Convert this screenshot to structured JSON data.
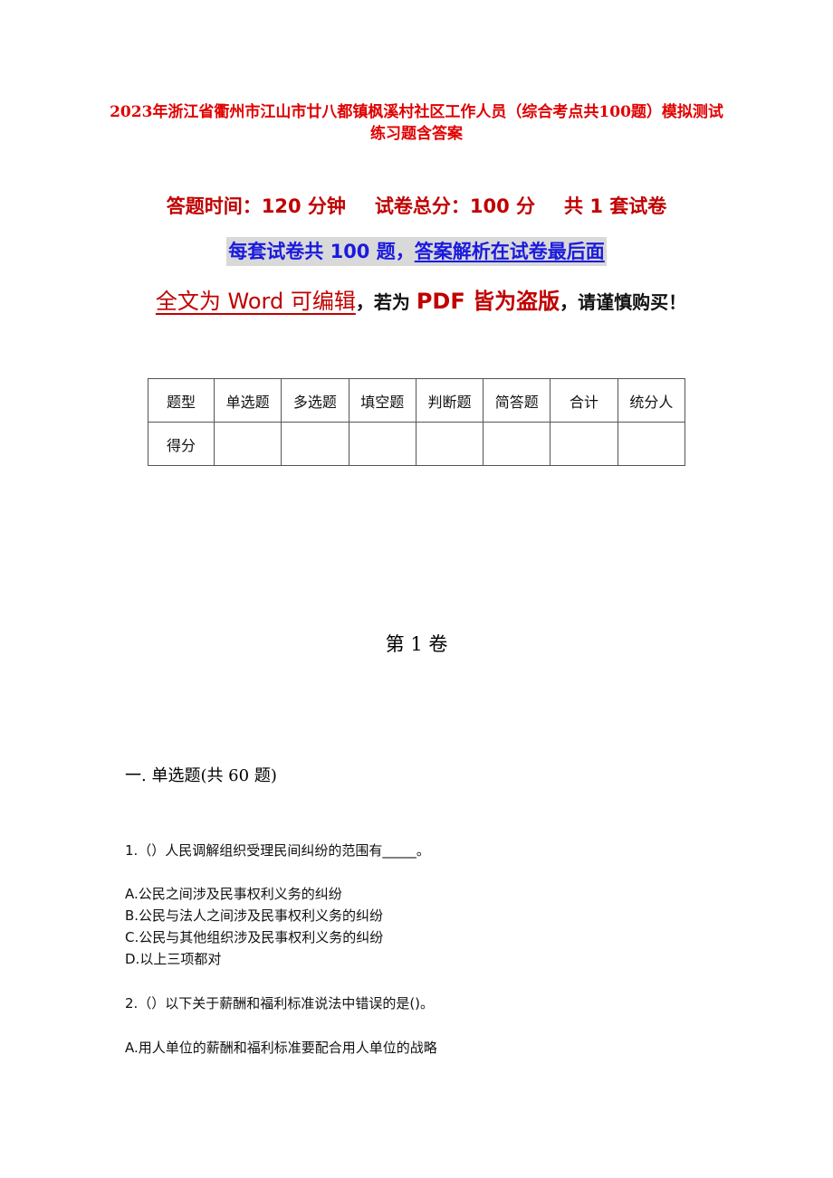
{
  "document": {
    "title": "2023年浙江省衢州市江山市廿八都镇枫溪村社区工作人员（综合考点共100题）模拟测试练习题含答案",
    "meta": {
      "time": "答题时间：120 分钟",
      "total_score": "试卷总分：100 分",
      "sets": "共 1 套试卷"
    },
    "notice": {
      "part1": "每套试卷共 100 题，",
      "part2": "答案解析在试卷最后面"
    },
    "warning": {
      "part1": "全文为 Word 可编辑",
      "part2": "，若为 ",
      "part3": "PDF 皆为盗版",
      "part4": "，请谨慎购买！"
    },
    "score_table": {
      "header": [
        "题型",
        "单选题",
        "多选题",
        "填空题",
        "判断题",
        "简答题",
        "合计",
        "统分人"
      ],
      "row": [
        "得分",
        "",
        "",
        "",
        "",
        "",
        "",
        ""
      ]
    },
    "volume_title": "第 1 卷",
    "section_title": "一. 单选题(共 60 题)",
    "questions": [
      {
        "stem": "1.（）人民调解组织受理民间纠纷的范围有_____。",
        "options": [
          "A.公民之间涉及民事权利义务的纠纷",
          "B.公民与法人之间涉及民事权利义务的纠纷",
          "C.公民与其他组织涉及民事权利义务的纠纷",
          "D.以上三项都对"
        ]
      },
      {
        "stem": "2.（）以下关于薪酬和福利标准说法中错误的是()。",
        "options": [
          "A.用人单位的薪酬和福利标准要配合用人单位的战略"
        ]
      }
    ]
  }
}
